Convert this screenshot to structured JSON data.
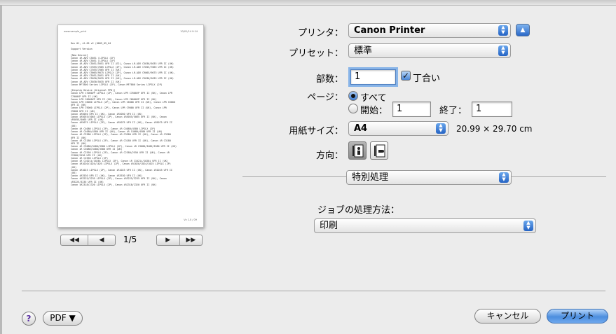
{
  "preview": {
    "header_left": "www.sample_print",
    "header_right": "10/01/14 9:14",
    "body_text": "Rev 01, v2.05 v2 (0005_05_04\n\nSupport Version\n\n[New Device]\nCanon iR-ADV C5051 (LIPSLX (2P)\nCanon iR-ADV C5051 (LIPSLX (2P)\nCanon iR-ADV C5051/5051 UFR II (E2), Canon iR-ADV C5030/5035 UFR II (UK)\nCanon iR-ADV C7055/7065 LIPSLX (2P), Canon iR-ADV C7055/7065 UFR II (UK)\nCanon iR-ADV C7055/7065 UFR II (UK)\nCanon iR-ADV C9065/9075 LIPSLX (2P), Canon iR-ADV C9065/9075 UFR II (UK),\nCanon iR-ADV C5051/5051 UFR II (UK)\nCanon iR-ADV C5030/5035 UFR II (UK), Canon iR-ADV C5030/5035 UFR II (UK)\nCanon iR-ADV C5030/5035 UFR II (UK)\nCanon MF7800 Series LIPSLX (2P), Canon MF7800 Series LIPSLX (2P)\n\n[Display Device (Original PPD)]\nCanon LPR C7000VP LIPSLX (2P), Canon LPR C7000VP UFR II (UK), Canon LPR\nC7000VP UFR II (UK)\nCanon LPR C6000VP UFR II (UK), Canon LPR C6000VP UFR II (UK)\nCanon LPR C6000 LIPSLX (2P), Canon LPR C6000 UFR II (UK), Canon LPR C6000\nUFR II (UK)\nCanon LPR C9000 LIPSLX (2P), Canon LPR C9000 UFR II (UK), Canon LPR\nC9000 UFR II (UK)\nCanon iR5050 UFR II (UK), Canon iR5050 UFR II (UK)\nCanon iR5055/5065 LIPSLX (2P), Canon iR5055/5065 UFR II (UK), Canon\niR5055/5065 UFR II (UK)\nCanon iR5075 LIPSLX (2P), Canon iR5075 UFR II (UK), Canon iR5075 UFR II\n(UK)\nCanon iR C4080 LIPSLX (2P), Canon iR C4080/4580 LIPSLX (2P)\nCanon iR C4080/4580 UFR II (UK), Canon iR C4080/4580 UFR II (UK)\nCanon iR C3380 LIPSLX (2P), Canon iR C3380 UFR II (UK), Canon iR C3380\nUFR II (UK)\nCanon iR C3180 LIPSLX (2P), Canon iR C3180 UFR II (UK), Canon iR C3180\nUFR II (UK)\nCanon iR C3080/3480/3580 LIPSLX (2P), Canon iR C3080/3480/3580 UFR II (UK)\nCanon iR C3080/3480/3580 UFR II (UK)\nCanon iR C2550 LIPSLX (2P), Canon iR C2380/2550 UFR II (UK), Canon iR\nC2380/2550 UFR II (UK)\nCanon iR C2550 LIPSLX (2P)\nCanon iR C1021i/1028i LIPSLX (2P), Canon iR C1021i/1028i UFR II (UK)\nCanon iR1020/1024/1025 LIPSLX (2P), Canon iR1020/1024/1025 LIPSLX (2P)\n(UK)\nCanon iR1023 LIPSLX (2P), Canon iR1023 UFR II (UK), Canon iR1025 UFR II\n(UK)\nCanon iR3530 UFR II (UK), Canon iR3530 UFR II (UK)\nCanon iR3225/3235 LIPSLX (2P), Canon iR3225/3235 UFR II (UK), Canon\niR3225/3235 UFR II (UK)\nCanon iR2318/2320 LIPSLX (2P), Canon iR2318/2320 UFR II (UK)",
    "footer": "Vz 1.0 / 09"
  },
  "preview_nav": {
    "first": "◀◀",
    "prev": "◀",
    "page": "1/5",
    "next": "▶",
    "last": "▶▶"
  },
  "printer": {
    "label": "プリンタ：",
    "value": "Canon Printer"
  },
  "presets": {
    "label": "プリセット：",
    "value": "標準"
  },
  "copies": {
    "label": "部数：",
    "value": "1",
    "collate_label": "丁合い"
  },
  "pages": {
    "label": "ページ：",
    "all_label": "すべて",
    "from_label": "開始：",
    "from_value": "1",
    "to_label": "終了：",
    "to_value": "1"
  },
  "paper_size": {
    "label": "用紙サイズ：",
    "value": "A4",
    "dimensions": "20.99 × 29.70 cm"
  },
  "orientation": {
    "label": "方向："
  },
  "section_popup": {
    "value": "特別処理"
  },
  "job_handling": {
    "label": "ジョブの処理方法：",
    "value": "印刷"
  },
  "footer": {
    "help": "?",
    "pdf_label": "PDF ▼",
    "cancel_label": "キャンセル",
    "print_label": "プリント"
  },
  "colors": {
    "accent": "#3d7bd4",
    "background": "#ececec"
  }
}
